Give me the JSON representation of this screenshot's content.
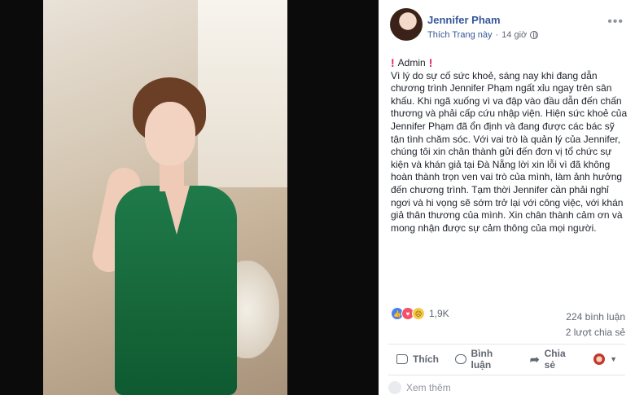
{
  "post": {
    "author": "Jennifer Pham",
    "like_page": "Thích Trang này",
    "separator": "·",
    "time": "14 giờ",
    "privacy_icon": "globe-icon",
    "admin_label": "Admin",
    "body": "Vì lý do sự cố sức khoẻ, sáng nay khi đang dẫn chương trình Jennifer Phạm ngất xỉu ngay trên sân khấu. Khi ngã xuống vì va đập vào đầu dẫn đến chấn thương và phải cấp cứu nhập viện. Hiện sức khoẻ của Jennifer Phạm đã ổn định và đang được các bác sỹ tận tình chăm sóc. Với vai trò là quản lý của Jennifer, chúng tôi xin chân thành gửi đến đơn vị tổ chức sự kiện và khán giả tại Đà Nẵng lời xin lỗi vì đã không hoàn thành trọn ven vai trò của mình, làm ảnh hưởng đến chương trình. Tạm thời Jennifer cần phải nghỉ ngơi và hi vọng sẽ sớm trở lại với công việc, với khán giả thân thương của mình. Xin chân thành cảm ơn và mong nhận được sự cảm thông của mọi người.",
    "reaction_count": "1,9K",
    "comments": "224 bình luận",
    "shares": "2 lượt chia sẻ",
    "actions": {
      "like": "Thích",
      "comment": "Bình luận",
      "share": "Chia sẻ"
    },
    "footer_peek": "Xem thêm"
  },
  "colors": {
    "link": "#365899",
    "meta": "#616770",
    "accent_like": "#4c7ff0",
    "accent_love": "#f25268"
  }
}
